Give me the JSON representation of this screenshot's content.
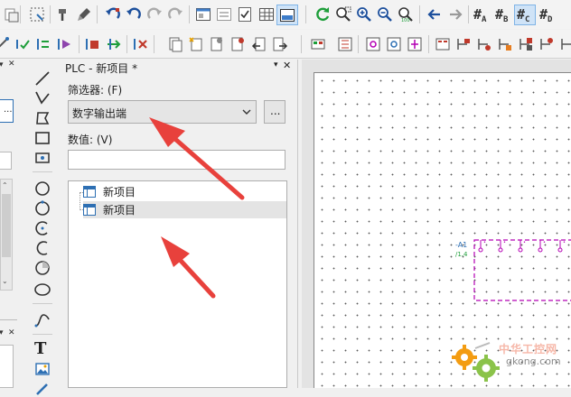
{
  "panel": {
    "title": "PLC - 新项目 *",
    "filter_label": "筛选器: (F)",
    "filter_value": "数字输出端",
    "more_label": "...",
    "value_label": "数值: (V)",
    "value_input": "",
    "tree_items": [
      "新项目",
      "新项目"
    ]
  },
  "left_panel": {
    "more_label": "..."
  },
  "canvas": {
    "device_tag": "-A1",
    "device_sub": "/1.4"
  },
  "watermark": {
    "site_cn": "中华工控网",
    "site_url": "gkong.com"
  },
  "colors": {
    "accent_blue": "#2d6fb3",
    "arrow_red": "#e8413c",
    "device_magenta": "#b400b4",
    "toolbar_green": "#1e9e3a"
  }
}
